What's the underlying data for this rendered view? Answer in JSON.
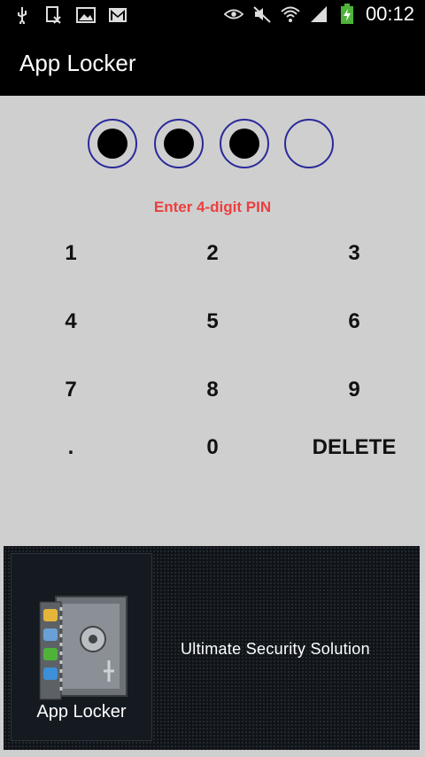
{
  "status": {
    "time": "00:12",
    "icons": [
      "usb-icon",
      "document-x-icon",
      "image-icon",
      "gmail-icon",
      "eye-icon",
      "mute-icon",
      "wifi-icon",
      "signal-icon",
      "battery-charging-icon"
    ]
  },
  "app": {
    "title": "App Locker"
  },
  "pin": {
    "entered": 3,
    "length": 4,
    "prompt": "Enter 4-digit PIN"
  },
  "keypad": {
    "rows": [
      [
        "1",
        "2",
        "3"
      ],
      [
        "4",
        "5",
        "6"
      ],
      [
        "7",
        "8",
        "9"
      ],
      [
        ".",
        "0",
        "DELETE"
      ]
    ]
  },
  "banner": {
    "logo_label": "App Locker",
    "tagline": "Ultimate Security Solution"
  }
}
